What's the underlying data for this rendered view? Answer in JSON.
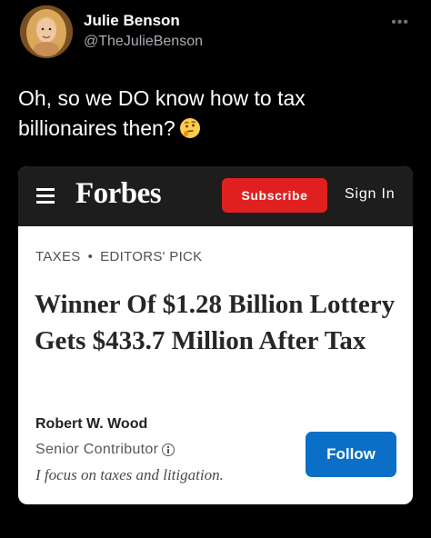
{
  "tweet": {
    "author_name": "Julie Benson",
    "author_handle": "@TheJulieBenson",
    "more_icon": "ellipsis-icon",
    "text": "Oh, so we DO know how to tax billionaires then?",
    "emoji": "thinking-face-emoji"
  },
  "card": {
    "brand": "Forbes",
    "menu_icon": "hamburger-menu-icon",
    "subscribe_label": "Subscribe",
    "signin_label": "Sign In",
    "breadcrumb_section": "TAXES",
    "breadcrumb_separator": "•",
    "breadcrumb_tag": "EDITORS' PICK",
    "headline": "Winner Of $1.28 Billion Lottery Gets $433.7 Million After Tax",
    "author": {
      "name": "Robert W. Wood",
      "role": "Senior Contributor",
      "info_icon": "info-icon",
      "bio": "I focus on taxes and litigation.",
      "follow_label": "Follow"
    }
  },
  "colors": {
    "background": "#000000",
    "forbes_bar": "#1d1d1d",
    "subscribe_red": "#e0201f",
    "follow_blue": "#0b6fc7"
  }
}
